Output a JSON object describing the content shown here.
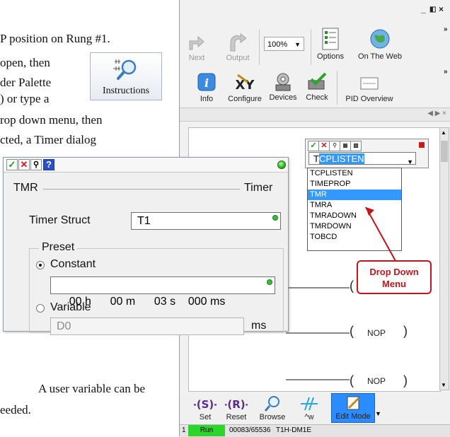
{
  "document": {
    "lines": [
      "P position on Rung #1.",
      "open, then",
      "der Palette",
      ") or type a",
      "rop down menu, then",
      "cted, a Timer dialog",
      "A user variable can be",
      "eeded."
    ]
  },
  "instructions_button": {
    "label": "Instructions",
    "icon": "magnifier-icon"
  },
  "app": {
    "window_controls": [
      "_",
      "×"
    ],
    "toolbar": [
      {
        "label": "Next",
        "icon": "next-icon",
        "enabled": false
      },
      {
        "label": "Output",
        "icon": "output-icon",
        "enabled": false
      },
      {
        "label": "Options",
        "icon": "options-icon",
        "enabled": true
      },
      {
        "label": "On The Web",
        "icon": "globe-icon",
        "enabled": true
      },
      {
        "label": "Info",
        "icon": "info-icon",
        "enabled": true
      },
      {
        "label": "Configure",
        "icon": "xy-icon",
        "enabled": true
      },
      {
        "label": "Devices",
        "icon": "devices-icon",
        "enabled": true
      },
      {
        "label": "Check",
        "icon": "check-icon",
        "enabled": true
      },
      {
        "label": "PID Overview",
        "icon": "pid-icon",
        "enabled": true
      }
    ],
    "zoom": "100%",
    "dropdown_editor": {
      "value_typed": "T",
      "value_selected": "CPLISTEN",
      "options": [
        "TCPLISTEN",
        "TIMEPROP",
        "TMR",
        "TMRA",
        "TMRADOWN",
        "TMRDOWN",
        "TOBCD"
      ],
      "active_option": "TMR"
    },
    "callout": "Drop Down Menu",
    "rungs": [
      "NOP",
      "NOP"
    ],
    "bottom_toolbar": [
      {
        "label": "Set",
        "icon": "set-coil-icon"
      },
      {
        "label": "Reset",
        "icon": "reset-coil-icon"
      },
      {
        "label": "Browse",
        "icon": "browse-icon"
      },
      {
        "label": "^w",
        "icon": "wire-icon"
      },
      {
        "label": "Edit Mode",
        "icon": "edit-mode-icon"
      }
    ],
    "status": {
      "number": "1",
      "mode": "Run",
      "memory": "00083/65536",
      "model": "T1H-DM1E"
    }
  },
  "timer_dialog": {
    "title_left": "TMR",
    "title_right": "Timer",
    "struct_label": "Timer Struct",
    "struct_value": "T1",
    "preset_label": "Preset",
    "constant_label": "Constant",
    "constant_value": "00 h      00 m      03 s    000 ms",
    "variable_label": "Variable",
    "variable_value": "D0",
    "variable_unit": "ms",
    "help_glyph": "?"
  },
  "colors": {
    "accent": "#3399ff",
    "run_status": "#2bd62b",
    "callout_red": "#c0161c",
    "ok_green": "#22a51c",
    "cancel_red": "#d01818"
  }
}
